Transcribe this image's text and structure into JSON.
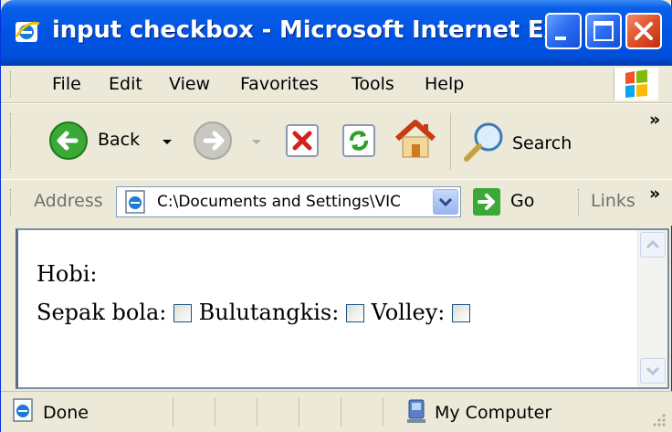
{
  "window": {
    "title": "input checkbox - Microsoft Internet Expl..."
  },
  "menu": {
    "items": [
      "File",
      "Edit",
      "View",
      "Favorites",
      "Tools",
      "Help"
    ]
  },
  "toolbar": {
    "back_label": "Back",
    "search_label": "Search",
    "overflow": "»"
  },
  "address": {
    "label": "Address",
    "value": "C:\\Documents and Settings\\VIC",
    "go_label": "Go",
    "links_label": "Links",
    "overflow": "»"
  },
  "page": {
    "heading": "Hobi:",
    "checkboxes": [
      {
        "label": "Sepak bola:",
        "checked": false
      },
      {
        "label": "Bulutangkis:",
        "checked": false
      },
      {
        "label": "Volley:",
        "checked": false
      }
    ]
  },
  "status": {
    "text": "Done",
    "zone": "My Computer"
  },
  "colors": {
    "title_bar": "#0054e3",
    "close_button": "#e0502a",
    "chrome": "#ece9d8"
  }
}
